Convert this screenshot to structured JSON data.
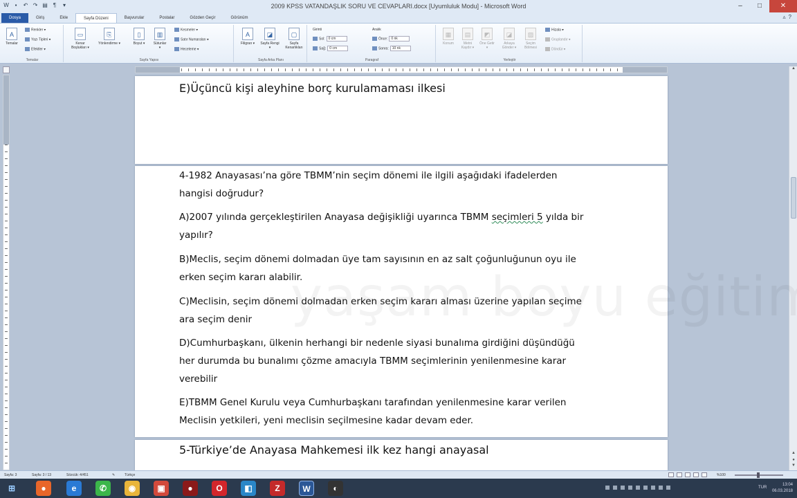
{
  "window": {
    "title": "2009 KPSS VATANDAŞLIK SORU VE CEVAPLARI.docx [Uyumluluk Modu] - Microsoft Word",
    "quick_access": [
      "save-icon",
      "undo-icon",
      "redo-icon",
      "print-preview-icon",
      "format-icon",
      "dropdown-icon"
    ],
    "controls": {
      "minimize": "–",
      "maximize": "□",
      "close": "✕"
    }
  },
  "tabs": [
    "Dosya",
    "Giriş",
    "Ekle",
    "Sayfa Düzeni",
    "Başvurular",
    "Postalar",
    "Gözden Geçir",
    "Görünüm"
  ],
  "active_tab": "Sayfa Düzeni",
  "ribbon": {
    "temalar": {
      "label": "Temalar",
      "buttons": [
        "Temalar"
      ],
      "small": [
        "Renkler ▾",
        "Yazı Tipleri ▾",
        "Efektler ▾"
      ]
    },
    "sayfa_yapisi": {
      "label": "Sayfa Yapısı",
      "buttons": [
        "Kenar Boşlukları ▾",
        "Yönlendirme ▾",
        "Boyut ▾",
        "Sütunlar ▾"
      ],
      "small": [
        "Kesmeler ▾",
        "Satır Numaraları ▾",
        "Heceleme ▾"
      ]
    },
    "sayfa_arka_plani": {
      "label": "Sayfa Arka Planı",
      "buttons": [
        "Filigran ▾",
        "Sayfa Rengi ▾",
        "Sayfa Kenarlıkları"
      ]
    },
    "paragraf": {
      "label": "Paragraf",
      "girinti": "Girinti",
      "aralik": "Aralık",
      "sol_label": "Sol:",
      "sol_value": "0 cm",
      "sag_label": "Sağ:",
      "sag_value": "0 cm",
      "once_label": "Önce:",
      "once_value": "0 nk",
      "sonra_label": "Sonra:",
      "sonra_value": "10 nk"
    },
    "yerlestir": {
      "label": "Yerleştir",
      "buttons": [
        "Konum",
        "Metni Kaydır ▾",
        "Öne Getir ▾",
        "Arkaya Gönder ▾",
        "Seçim Bölmesi"
      ],
      "small": [
        "Hizala ▾",
        "Gruplandır ▾",
        "Döndür ▾"
      ]
    }
  },
  "document": {
    "page1_line": "E)Üçüncü kişi aleyhine borç kurulamaması ilkesi",
    "q4_lines": [
      "4-1982 Anayasası’na göre TBMM’nin seçim dönemi ile ilgili aşağıdaki ifadelerden",
      "hangisi doğrudur?"
    ],
    "optA_pre": "A)2007 yılında gerçekleştirilen Anayasa değişikliği uyarınca TBMM ",
    "optA_wavy": "seçimleri  5",
    "optA_post": " yılda bir",
    "optA_line2": "yapılır?",
    "optB": [
      "B)Meclis, seçim dönemi dolmadan üye tam sayısının en az salt çoğunluğunun oyu ile",
      "erken seçim kararı alabilir."
    ],
    "optC": [
      "C)Meclisin, seçim dönemi dolmadan erken seçim kararı alması üzerine yapılan seçime",
      "ara seçim denir"
    ],
    "optD": [
      "D)Cumhurbaşkanı, ülkenin herhangi bir nedenle siyasi bunalıma girdiğini düşündüğü",
      "her durumda bu bunalımı çözme amacıyla TBMM seçimlerinin yenilenmesine karar",
      "verebilir"
    ],
    "optE": [
      "E)TBMM Genel Kurulu veya Cumhurbaşkanı tarafından yenilenmesine karar verilen",
      "Meclisin yetkileri, yeni meclisin seçilmesine kadar devam eder."
    ],
    "q5": "5-Türkiye’de Anayasa Mahkemesi ilk kez hangi anayasal",
    "watermark": "yaşam boyu eğitim"
  },
  "statusbar": {
    "page": "Sayfa: 3",
    "section": "Sayfa: 3 / 13",
    "words": "Sözcük: 4/451",
    "language": "Türkçe",
    "zoom": "%100"
  },
  "taskbar": {
    "apps": [
      "start",
      "firefox",
      "ie",
      "whatsapp",
      "chrome",
      "app-red",
      "app-media",
      "opera",
      "app-blue",
      "z-app",
      "word",
      "app-dark"
    ],
    "time": "13:04",
    "date": "06.03.2018",
    "lang": "TUR"
  }
}
